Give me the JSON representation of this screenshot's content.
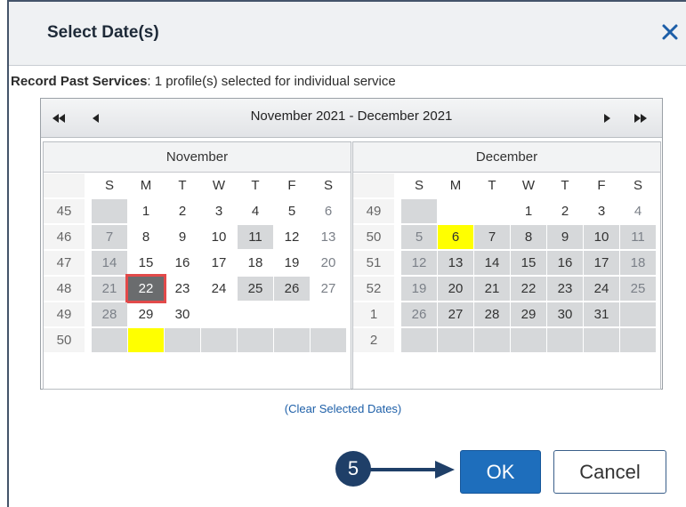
{
  "dialog": {
    "title": "Select Date(s)",
    "close_icon": "close-icon",
    "subtitle_label": "Record Past Services",
    "subtitle_text": ":  1 profile(s) selected for individual service"
  },
  "calendar": {
    "range_title": "November 2021 - December 2021",
    "nav_icons": [
      "double-left-arrow-icon",
      "left-arrow-icon",
      "right-arrow-icon",
      "double-right-arrow-icon"
    ],
    "day_headers": [
      "S",
      "M",
      "T",
      "W",
      "T",
      "F",
      "S"
    ],
    "months": [
      {
        "name": "November",
        "weeks": [
          {
            "wk": "45",
            "days": [
              "",
              "1",
              "2",
              "3",
              "4",
              "5",
              "6"
            ]
          },
          {
            "wk": "46",
            "days": [
              "7",
              "8",
              "9",
              "10",
              "11",
              "12",
              "13"
            ]
          },
          {
            "wk": "47",
            "days": [
              "14",
              "15",
              "16",
              "17",
              "18",
              "19",
              "20"
            ]
          },
          {
            "wk": "48",
            "days": [
              "21",
              "22",
              "23",
              "24",
              "25",
              "26",
              "27"
            ]
          },
          {
            "wk": "49",
            "days": [
              "28",
              "29",
              "30",
              "",
              "",
              "",
              ""
            ]
          },
          {
            "wk": "50",
            "days": [
              "",
              "",
              "",
              "",
              "",
              "",
              ""
            ]
          }
        ]
      },
      {
        "name": "December",
        "weeks": [
          {
            "wk": "49",
            "days": [
              "",
              "",
              "",
              "1",
              "2",
              "3",
              "4"
            ]
          },
          {
            "wk": "50",
            "days": [
              "5",
              "6",
              "7",
              "8",
              "9",
              "10",
              "11"
            ]
          },
          {
            "wk": "51",
            "days": [
              "12",
              "13",
              "14",
              "15",
              "16",
              "17",
              "18"
            ]
          },
          {
            "wk": "52",
            "days": [
              "19",
              "20",
              "21",
              "22",
              "23",
              "24",
              "25"
            ]
          },
          {
            "wk": "1",
            "days": [
              "26",
              "27",
              "28",
              "29",
              "30",
              "31",
              ""
            ]
          },
          {
            "wk": "2",
            "days": [
              "",
              "",
              "",
              "",
              "",
              "",
              ""
            ]
          }
        ]
      }
    ],
    "selected_date": "22",
    "highlight_color": "#ffff00",
    "selected_color": "#6a6c6e"
  },
  "clear_link": "(Clear Selected Dates)",
  "annotation": {
    "step_number": "5"
  },
  "buttons": {
    "ok": "OK",
    "cancel": "Cancel"
  },
  "colors": {
    "accent": "#1e6ebc",
    "step_badge": "#1f3f68",
    "callout_box": "#e24a4a"
  }
}
